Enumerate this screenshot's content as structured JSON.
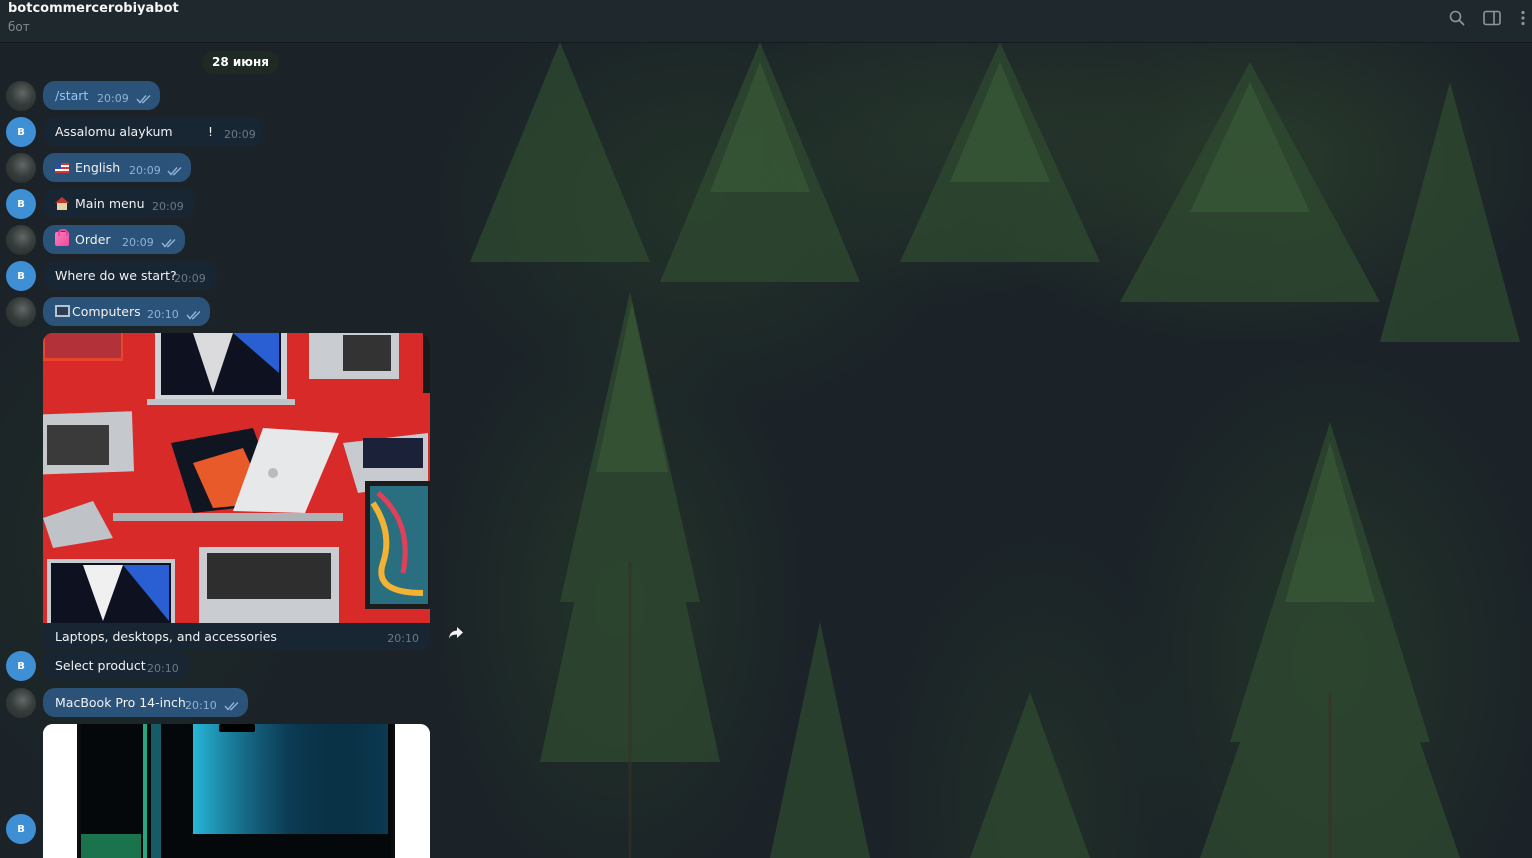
{
  "header": {
    "title": "botcommercerobiyabot",
    "subtitle": "бот",
    "icons": [
      "search-icon",
      "sidebar-toggle-icon",
      "more-vertical-icon"
    ]
  },
  "date_separator": "28 июня",
  "messages": [
    {
      "from": "user",
      "text": "/start",
      "time": "20:09",
      "status": "read"
    },
    {
      "from": "bot",
      "avatar_letter": "B",
      "text": "Assalomu alaykum",
      "extra": "!",
      "time": "20:09"
    },
    {
      "from": "user",
      "emoji": "flag-us",
      "text": "English",
      "time": "20:09",
      "status": "read"
    },
    {
      "from": "bot",
      "avatar_letter": "B",
      "emoji": "house",
      "text": "Main menu",
      "time": "20:09"
    },
    {
      "from": "user",
      "emoji": "shopping-bags",
      "text": "Order",
      "time": "20:09",
      "status": "read"
    },
    {
      "from": "bot",
      "avatar_letter": "B",
      "text": "Where do we start?",
      "time": "20:09"
    },
    {
      "from": "user",
      "emoji": "desktop-computer",
      "text": "Computers",
      "time": "20:10",
      "status": "read"
    },
    {
      "from": "bot",
      "type": "photo",
      "caption": "Laptops, desktops, and accessories",
      "time": "20:10"
    },
    {
      "from": "bot",
      "avatar_letter": "B",
      "text": "Select product",
      "time": "20:10"
    },
    {
      "from": "user",
      "text": "MacBook Pro 14-inch",
      "time": "20:10",
      "status": "read"
    },
    {
      "from": "bot",
      "avatar_letter": "B",
      "type": "photo"
    }
  ],
  "colors": {
    "outgoing_bubble": "#2b5278",
    "incoming_bubble": "#182533",
    "bot_avatar": "#3e8fd3",
    "header": "#1e282d"
  }
}
